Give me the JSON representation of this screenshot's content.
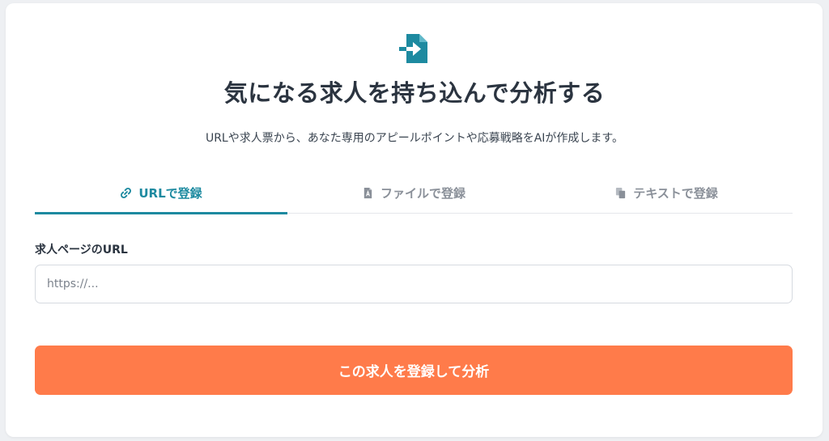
{
  "header": {
    "icon": "file-import-icon",
    "title": "気になる求人を持ち込んで分析する",
    "subtitle": "URLや求人票から、あなた専用のアピールポイントや応募戦略をAIが作成します。"
  },
  "tabs": [
    {
      "label": "URLで登録",
      "icon": "link-icon",
      "active": true
    },
    {
      "label": "ファイルで登録",
      "icon": "file-pdf-icon",
      "active": false
    },
    {
      "label": "テキストで登録",
      "icon": "copy-icon",
      "active": false
    }
  ],
  "form": {
    "url_label": "求人ページのURL",
    "url_placeholder": "https://...",
    "url_value": "",
    "submit_label": "この求人を登録して分析"
  },
  "colors": {
    "accent": "#1d8aa0",
    "primary_button": "#ff7b4a",
    "text": "#2b3440",
    "muted": "#8a9099"
  }
}
